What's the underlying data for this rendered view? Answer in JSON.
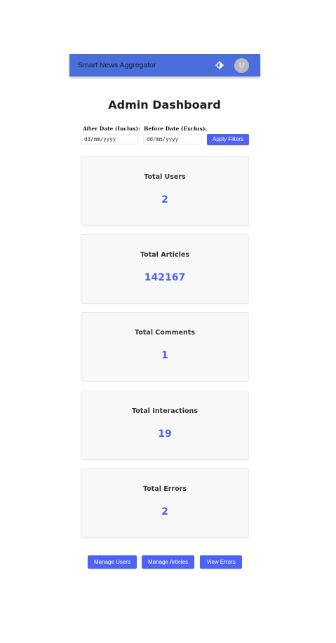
{
  "navbar": {
    "brand": "Smart News Aggregator",
    "theme_icon": "theme-toggle-icon",
    "avatar_initial": "U",
    "colors": {
      "navbar_bg": "#4a6fdc",
      "avatar_bg": "#b9b9c2"
    }
  },
  "page": {
    "title": "Admin Dashboard"
  },
  "filters": {
    "after_label": "After Date (Inclus):",
    "after_placeholder": "dd/mm/yyyy",
    "after_value": "",
    "before_label": "Before Date (Exclus):",
    "before_placeholder": "dd/mm/yyyy",
    "before_value": "",
    "apply_label": "Apply Filters"
  },
  "stats": [
    {
      "label": "Total Users",
      "value": "2"
    },
    {
      "label": "Total Articles",
      "value": "142167"
    },
    {
      "label": "Total Comments",
      "value": "1"
    },
    {
      "label": "Total Interactions",
      "value": "19"
    },
    {
      "label": "Total Errors",
      "value": "2"
    }
  ],
  "actions": {
    "manage_users": "Manage Users",
    "manage_articles": "Manage Articles",
    "view_errors": "View Errors"
  },
  "colors": {
    "accent": "#4d63f5",
    "card_bg": "#f8f8f8"
  }
}
